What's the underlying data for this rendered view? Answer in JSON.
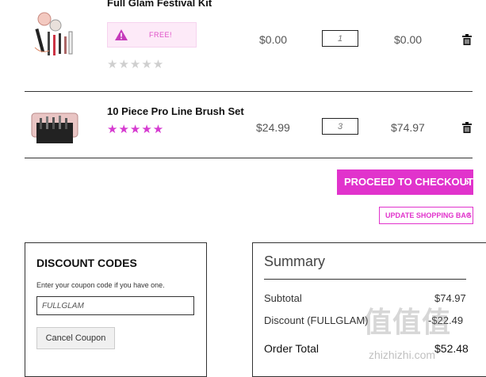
{
  "items": [
    {
      "name": "Full Glam Festival Kit",
      "badge": "FREE!",
      "price": "$0.00",
      "qty": "1",
      "total": "$0.00",
      "rating": 0
    },
    {
      "name": "10 Piece Pro Line Brush Set",
      "price": "$24.99",
      "qty": "3",
      "total": "$74.97",
      "rating": 5
    }
  ],
  "actions": {
    "checkout": "PROCEED TO CHECKOUT",
    "update": "UPDATE SHOPPING BAG"
  },
  "discount": {
    "title": "DISCOUNT CODES",
    "hint": "Enter your coupon code if you have one.",
    "code": "FULLGLAM",
    "cancel": "Cancel Coupon"
  },
  "summary": {
    "title": "Summary",
    "subtotal_label": "Subtotal",
    "subtotal_value": "$74.97",
    "discount_label": "Discount (FULLGLAM)",
    "discount_value": "-$22.49",
    "total_label": "Order Total",
    "total_value": "$52.48"
  },
  "colors": {
    "accent": "#e133cc",
    "star": "#d63ad0"
  },
  "watermark": {
    "brand": "值值值",
    "url": "zhizhizhi.com"
  }
}
